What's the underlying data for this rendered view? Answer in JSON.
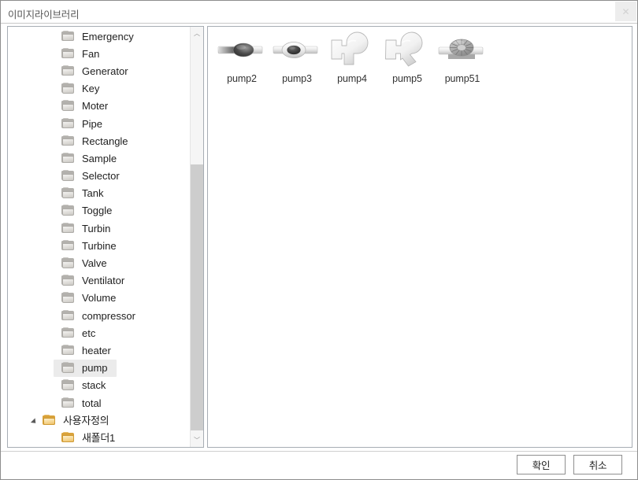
{
  "window": {
    "title": "이미지라이브러리",
    "close_label": "✕"
  },
  "tree": {
    "scrollbar": {
      "up_arrow": "︿",
      "down_arrow": "﹀"
    },
    "items": [
      {
        "label": "Emergency",
        "icon": "folder-gray-icon",
        "indent": 68,
        "expander": "none",
        "selected": false,
        "lang": "en"
      },
      {
        "label": "Fan",
        "icon": "folder-gray-icon",
        "indent": 68,
        "expander": "none",
        "selected": false,
        "lang": "en"
      },
      {
        "label": "Generator",
        "icon": "folder-gray-icon",
        "indent": 68,
        "expander": "none",
        "selected": false,
        "lang": "en"
      },
      {
        "label": "Key",
        "icon": "folder-gray-icon",
        "indent": 68,
        "expander": "none",
        "selected": false,
        "lang": "en"
      },
      {
        "label": "Moter",
        "icon": "folder-gray-icon",
        "indent": 68,
        "expander": "none",
        "selected": false,
        "lang": "en"
      },
      {
        "label": "Pipe",
        "icon": "folder-gray-icon",
        "indent": 68,
        "expander": "none",
        "selected": false,
        "lang": "en"
      },
      {
        "label": "Rectangle",
        "icon": "folder-gray-icon",
        "indent": 68,
        "expander": "none",
        "selected": false,
        "lang": "en"
      },
      {
        "label": "Sample",
        "icon": "folder-gray-icon",
        "indent": 68,
        "expander": "none",
        "selected": false,
        "lang": "en"
      },
      {
        "label": "Selector",
        "icon": "folder-gray-icon",
        "indent": 68,
        "expander": "none",
        "selected": false,
        "lang": "en"
      },
      {
        "label": "Tank",
        "icon": "folder-gray-icon",
        "indent": 68,
        "expander": "none",
        "selected": false,
        "lang": "en"
      },
      {
        "label": "Toggle",
        "icon": "folder-gray-icon",
        "indent": 68,
        "expander": "none",
        "selected": false,
        "lang": "en"
      },
      {
        "label": "Turbin",
        "icon": "folder-gray-icon",
        "indent": 68,
        "expander": "none",
        "selected": false,
        "lang": "en"
      },
      {
        "label": "Turbine",
        "icon": "folder-gray-icon",
        "indent": 68,
        "expander": "none",
        "selected": false,
        "lang": "en"
      },
      {
        "label": "Valve",
        "icon": "folder-gray-icon",
        "indent": 68,
        "expander": "none",
        "selected": false,
        "lang": "en"
      },
      {
        "label": "Ventilator",
        "icon": "folder-gray-icon",
        "indent": 68,
        "expander": "none",
        "selected": false,
        "lang": "en"
      },
      {
        "label": "Volume",
        "icon": "folder-gray-icon",
        "indent": 68,
        "expander": "none",
        "selected": false,
        "lang": "en"
      },
      {
        "label": "compressor",
        "icon": "folder-gray-icon",
        "indent": 68,
        "expander": "none",
        "selected": false,
        "lang": "en"
      },
      {
        "label": "etc",
        "icon": "folder-gray-icon",
        "indent": 68,
        "expander": "none",
        "selected": false,
        "lang": "en"
      },
      {
        "label": "heater",
        "icon": "folder-gray-icon",
        "indent": 68,
        "expander": "none",
        "selected": false,
        "lang": "en"
      },
      {
        "label": "pump",
        "icon": "folder-gray-icon",
        "indent": 68,
        "expander": "none",
        "selected": true,
        "lang": "en"
      },
      {
        "label": "stack",
        "icon": "folder-gray-icon",
        "indent": 68,
        "expander": "none",
        "selected": false,
        "lang": "en"
      },
      {
        "label": "total",
        "icon": "folder-gray-icon",
        "indent": 68,
        "expander": "none",
        "selected": false,
        "lang": "en"
      },
      {
        "label": "사용자정의",
        "icon": "folder-yellow-icon",
        "indent": 29,
        "expander": "expanded",
        "selected": false,
        "lang": "ko"
      },
      {
        "label": "새폴더1",
        "icon": "folder-yellow-icon",
        "indent": 68,
        "expander": "none",
        "selected": false,
        "lang": "ko"
      }
    ]
  },
  "content": {
    "thumbnails": [
      {
        "label": "pump2",
        "icon": "pump-inline-bulb-icon"
      },
      {
        "label": "pump3",
        "icon": "pump-inline-rotor-icon"
      },
      {
        "label": "pump4",
        "icon": "pump-centrifugal-icon"
      },
      {
        "label": "pump5",
        "icon": "pump-centrifugal-angled-icon"
      },
      {
        "label": "pump51",
        "icon": "pump-impeller-icon"
      }
    ]
  },
  "footer": {
    "ok_label": "확인",
    "cancel_label": "취소"
  },
  "colors": {
    "window_border": "#8d8d8d",
    "panel_border": "#a7adb4",
    "selection": "#ebebeb",
    "scroll_thumb": "#cdcdcd",
    "folder_gray": "#dedcd8",
    "folder_yellow": "#f6d896",
    "text": "#1e1e1e",
    "title_text": "#555555"
  }
}
